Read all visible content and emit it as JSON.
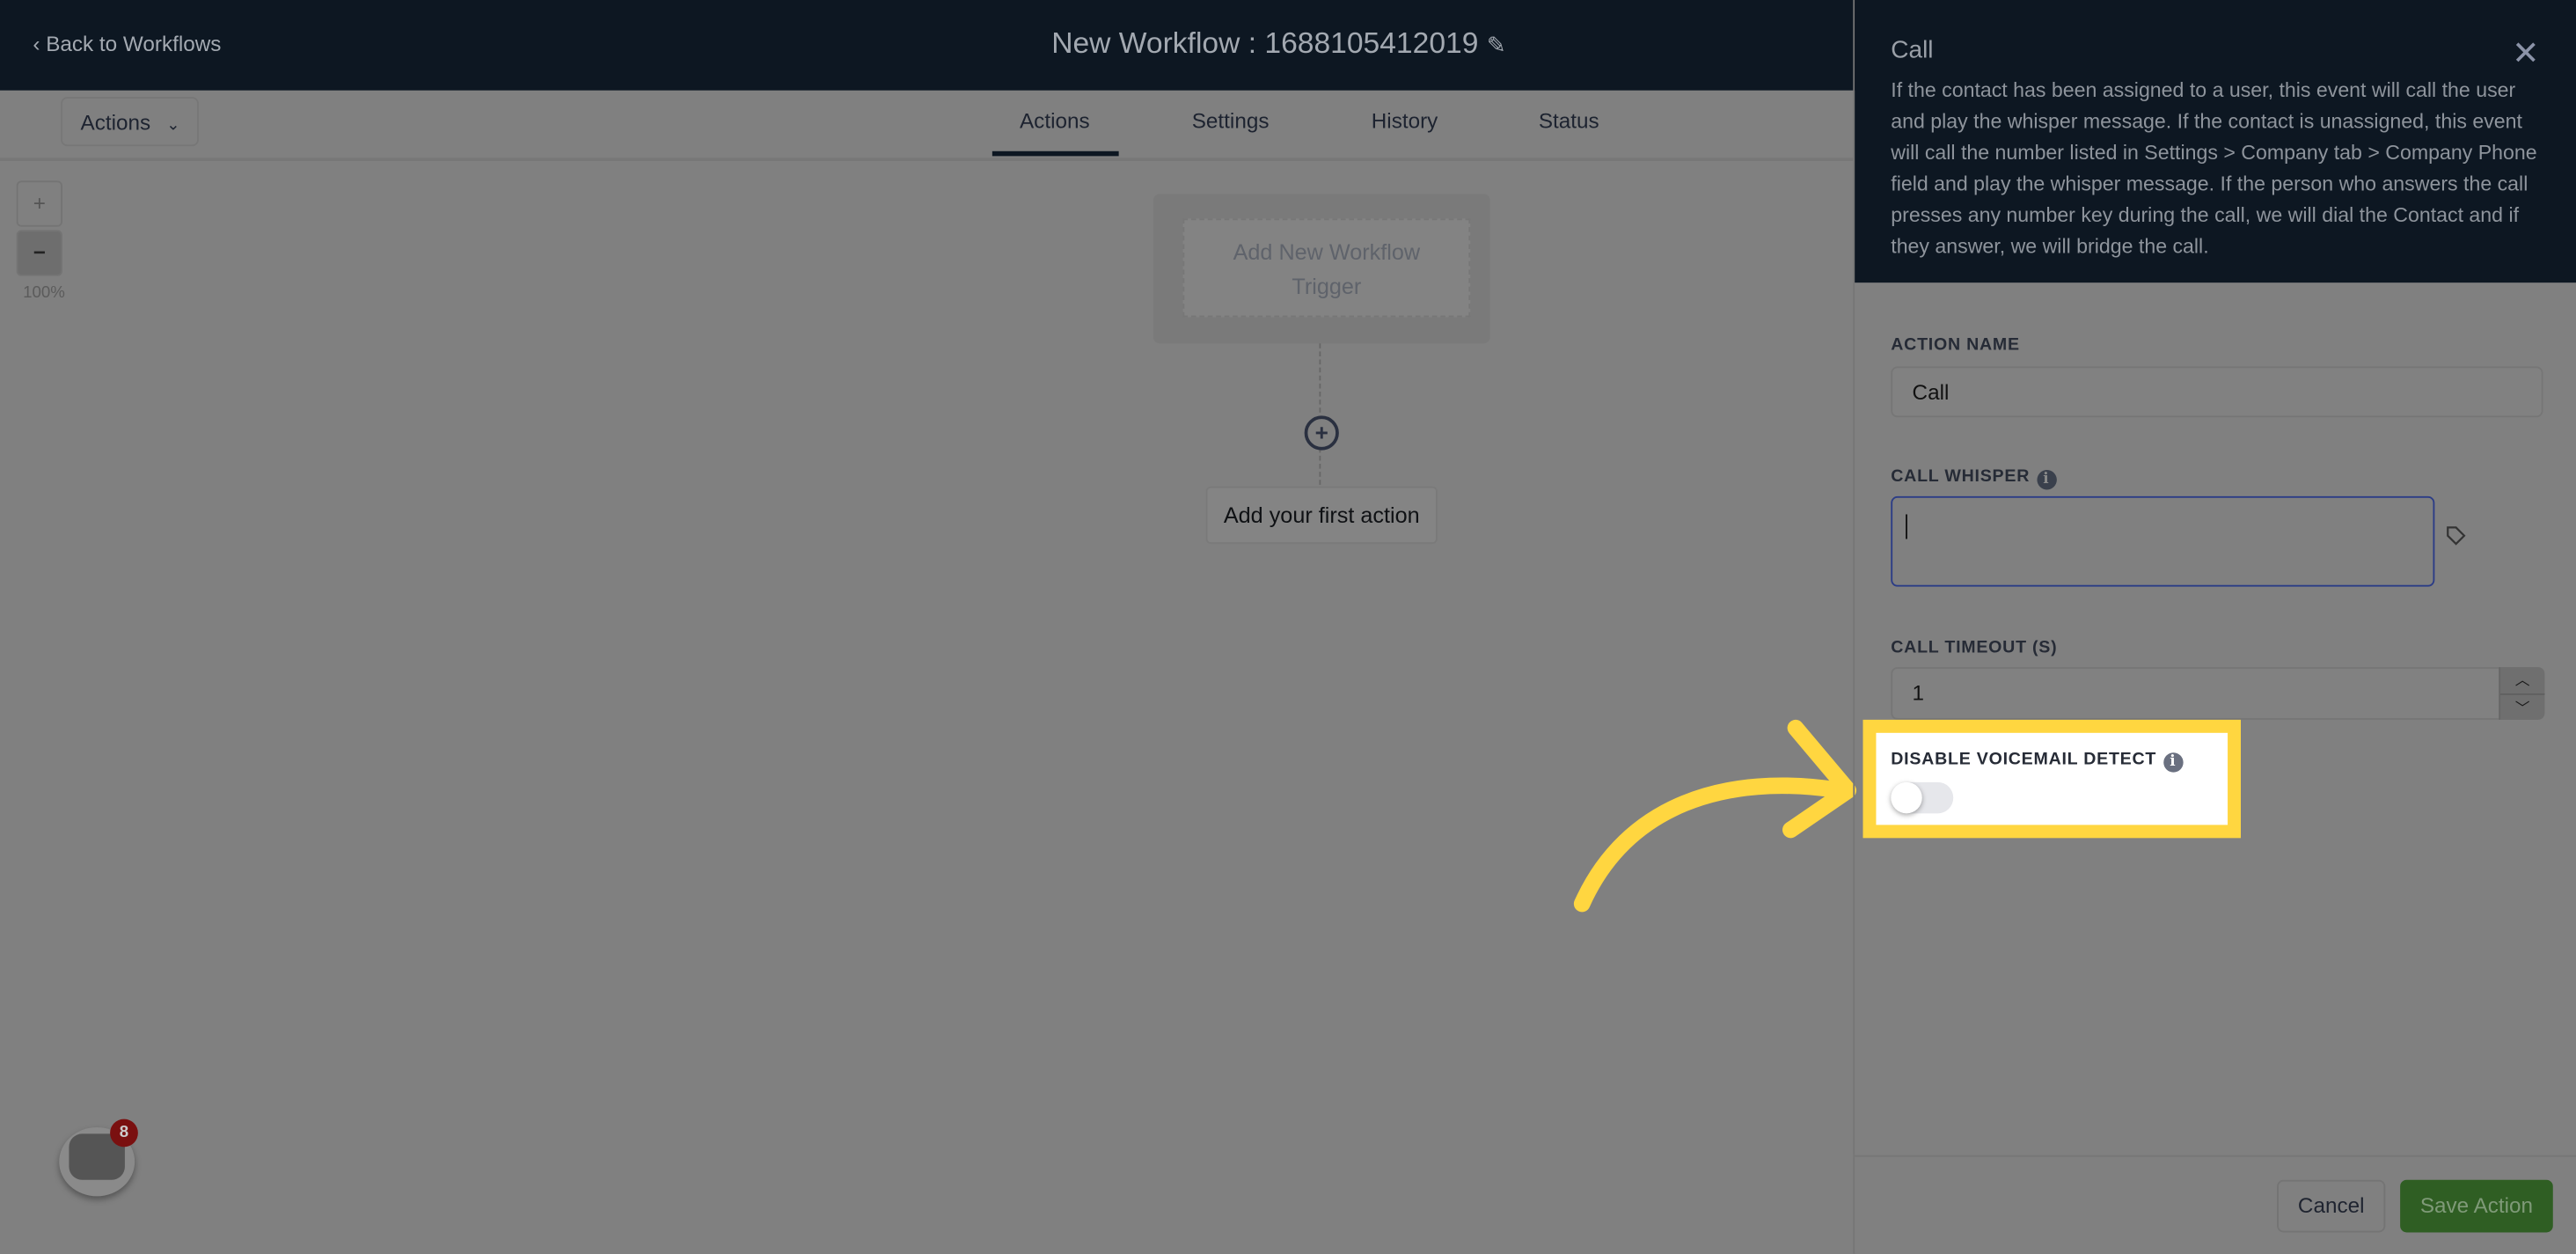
{
  "header": {
    "back_label": "Back to Workflows",
    "title": "New Workflow : 1688105412019"
  },
  "toolbar": {
    "actions_dropdown": "Actions",
    "tabs": [
      {
        "label": "Actions",
        "active": true
      },
      {
        "label": "Settings"
      },
      {
        "label": "History"
      },
      {
        "label": "Status"
      }
    ]
  },
  "canvas": {
    "zoom_in": "+",
    "zoom_out": "−",
    "zoom_level": "100%",
    "trigger_placeholder": "Add New Workflow Trigger",
    "add_first_action": "Add your first action"
  },
  "panel": {
    "title": "Call",
    "description": "If the contact has been assigned to a user, this event will call the user and play the whisper message. If the contact is unassigned, this event will call the number listed in Settings > Company tab > Company Phone field and play the whisper message. If the person who answers the call presses any number key during the call, we will dial the Contact and if they answer, we will bridge the call.",
    "action_name_label": "ACTION NAME",
    "action_name_value": "Call",
    "call_whisper_label": "CALL WHISPER",
    "call_whisper_value": "",
    "call_timeout_label": "CALL TIMEOUT (S)",
    "call_timeout_value": "1",
    "disable_voicemail_label": "DISABLE VOICEMAIL DETECT",
    "disable_voicemail_enabled": false,
    "cancel_label": "Cancel",
    "save_label": "Save Action"
  },
  "chat_widget": {
    "badge_count": "8"
  },
  "colors": {
    "header_bg": "#0d1722",
    "save_green": "#2f5e23",
    "highlight_yellow": "#ffd640",
    "badge_red": "#7a1010"
  }
}
